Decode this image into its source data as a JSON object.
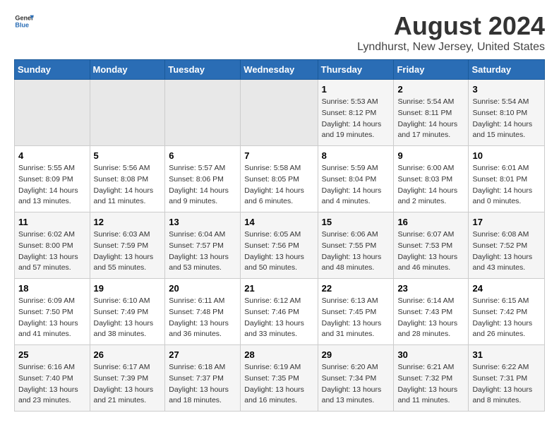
{
  "header": {
    "logo_general": "General",
    "logo_blue": "Blue",
    "title": "August 2024",
    "subtitle": "Lyndhurst, New Jersey, United States"
  },
  "days_of_week": [
    "Sunday",
    "Monday",
    "Tuesday",
    "Wednesday",
    "Thursday",
    "Friday",
    "Saturday"
  ],
  "weeks": [
    [
      {
        "num": "",
        "info": ""
      },
      {
        "num": "",
        "info": ""
      },
      {
        "num": "",
        "info": ""
      },
      {
        "num": "",
        "info": ""
      },
      {
        "num": "1",
        "info": "Sunrise: 5:53 AM\nSunset: 8:12 PM\nDaylight: 14 hours and 19 minutes."
      },
      {
        "num": "2",
        "info": "Sunrise: 5:54 AM\nSunset: 8:11 PM\nDaylight: 14 hours and 17 minutes."
      },
      {
        "num": "3",
        "info": "Sunrise: 5:54 AM\nSunset: 8:10 PM\nDaylight: 14 hours and 15 minutes."
      }
    ],
    [
      {
        "num": "4",
        "info": "Sunrise: 5:55 AM\nSunset: 8:09 PM\nDaylight: 14 hours and 13 minutes."
      },
      {
        "num": "5",
        "info": "Sunrise: 5:56 AM\nSunset: 8:08 PM\nDaylight: 14 hours and 11 minutes."
      },
      {
        "num": "6",
        "info": "Sunrise: 5:57 AM\nSunset: 8:06 PM\nDaylight: 14 hours and 9 minutes."
      },
      {
        "num": "7",
        "info": "Sunrise: 5:58 AM\nSunset: 8:05 PM\nDaylight: 14 hours and 6 minutes."
      },
      {
        "num": "8",
        "info": "Sunrise: 5:59 AM\nSunset: 8:04 PM\nDaylight: 14 hours and 4 minutes."
      },
      {
        "num": "9",
        "info": "Sunrise: 6:00 AM\nSunset: 8:03 PM\nDaylight: 14 hours and 2 minutes."
      },
      {
        "num": "10",
        "info": "Sunrise: 6:01 AM\nSunset: 8:01 PM\nDaylight: 14 hours and 0 minutes."
      }
    ],
    [
      {
        "num": "11",
        "info": "Sunrise: 6:02 AM\nSunset: 8:00 PM\nDaylight: 13 hours and 57 minutes."
      },
      {
        "num": "12",
        "info": "Sunrise: 6:03 AM\nSunset: 7:59 PM\nDaylight: 13 hours and 55 minutes."
      },
      {
        "num": "13",
        "info": "Sunrise: 6:04 AM\nSunset: 7:57 PM\nDaylight: 13 hours and 53 minutes."
      },
      {
        "num": "14",
        "info": "Sunrise: 6:05 AM\nSunset: 7:56 PM\nDaylight: 13 hours and 50 minutes."
      },
      {
        "num": "15",
        "info": "Sunrise: 6:06 AM\nSunset: 7:55 PM\nDaylight: 13 hours and 48 minutes."
      },
      {
        "num": "16",
        "info": "Sunrise: 6:07 AM\nSunset: 7:53 PM\nDaylight: 13 hours and 46 minutes."
      },
      {
        "num": "17",
        "info": "Sunrise: 6:08 AM\nSunset: 7:52 PM\nDaylight: 13 hours and 43 minutes."
      }
    ],
    [
      {
        "num": "18",
        "info": "Sunrise: 6:09 AM\nSunset: 7:50 PM\nDaylight: 13 hours and 41 minutes."
      },
      {
        "num": "19",
        "info": "Sunrise: 6:10 AM\nSunset: 7:49 PM\nDaylight: 13 hours and 38 minutes."
      },
      {
        "num": "20",
        "info": "Sunrise: 6:11 AM\nSunset: 7:48 PM\nDaylight: 13 hours and 36 minutes."
      },
      {
        "num": "21",
        "info": "Sunrise: 6:12 AM\nSunset: 7:46 PM\nDaylight: 13 hours and 33 minutes."
      },
      {
        "num": "22",
        "info": "Sunrise: 6:13 AM\nSunset: 7:45 PM\nDaylight: 13 hours and 31 minutes."
      },
      {
        "num": "23",
        "info": "Sunrise: 6:14 AM\nSunset: 7:43 PM\nDaylight: 13 hours and 28 minutes."
      },
      {
        "num": "24",
        "info": "Sunrise: 6:15 AM\nSunset: 7:42 PM\nDaylight: 13 hours and 26 minutes."
      }
    ],
    [
      {
        "num": "25",
        "info": "Sunrise: 6:16 AM\nSunset: 7:40 PM\nDaylight: 13 hours and 23 minutes."
      },
      {
        "num": "26",
        "info": "Sunrise: 6:17 AM\nSunset: 7:39 PM\nDaylight: 13 hours and 21 minutes."
      },
      {
        "num": "27",
        "info": "Sunrise: 6:18 AM\nSunset: 7:37 PM\nDaylight: 13 hours and 18 minutes."
      },
      {
        "num": "28",
        "info": "Sunrise: 6:19 AM\nSunset: 7:35 PM\nDaylight: 13 hours and 16 minutes."
      },
      {
        "num": "29",
        "info": "Sunrise: 6:20 AM\nSunset: 7:34 PM\nDaylight: 13 hours and 13 minutes."
      },
      {
        "num": "30",
        "info": "Sunrise: 6:21 AM\nSunset: 7:32 PM\nDaylight: 13 hours and 11 minutes."
      },
      {
        "num": "31",
        "info": "Sunrise: 6:22 AM\nSunset: 7:31 PM\nDaylight: 13 hours and 8 minutes."
      }
    ]
  ]
}
